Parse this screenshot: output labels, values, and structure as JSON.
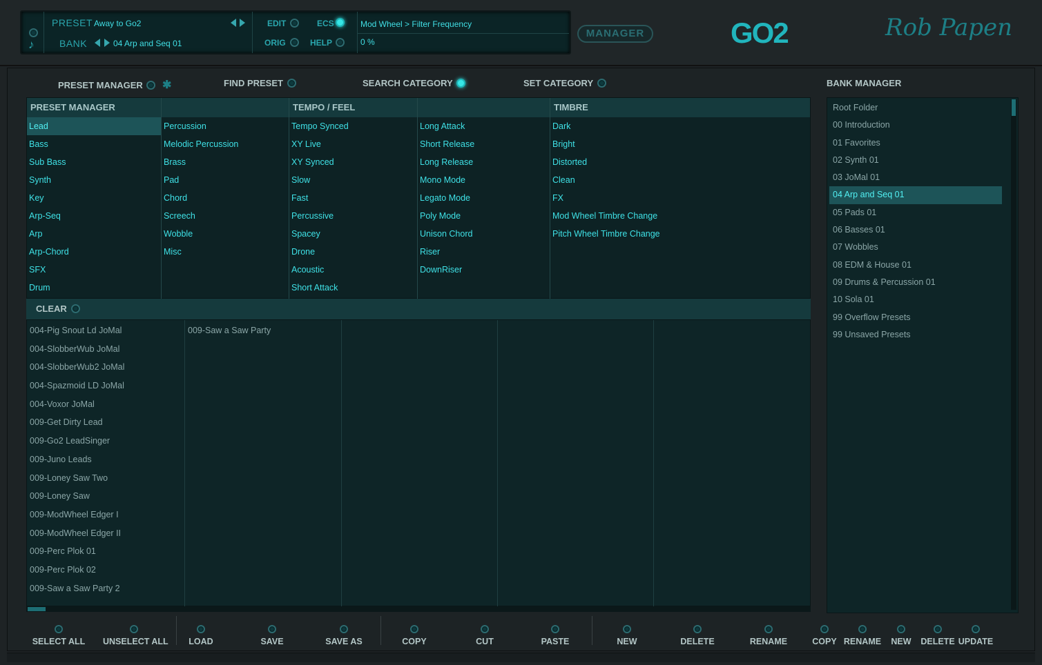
{
  "header": {
    "preset_label": "PRESET",
    "preset_name": "Away to Go2",
    "bank_label": "BANK",
    "bank_name": "04 Arp and Seq 01",
    "edit_label": "EDIT",
    "ecs_label": "ECS",
    "orig_label": "ORIG",
    "help_label": "HELP",
    "display_line1": "Mod Wheel > Filter Frequency",
    "display_line2": "0 %",
    "manager_button": "MANAGER",
    "logo_text": "GO2",
    "brand_text": "Rob Papen"
  },
  "tabs": {
    "preset_manager": "PRESET MANAGER",
    "find_preset": "FIND PRESET",
    "search_category": "SEARCH CATEGORY",
    "set_category": "SET CATEGORY",
    "bank_manager": "BANK MANAGER"
  },
  "categories": {
    "col1_header": "PRESET MANAGER",
    "col1": [
      "Lead",
      "Bass",
      "Sub Bass",
      "Synth",
      "Key",
      "Arp-Seq",
      "Arp",
      "Arp-Chord",
      "SFX",
      "Drum"
    ],
    "col2_header": "",
    "col2": [
      "Percussion",
      "Melodic Percussion",
      "Brass",
      "Pad",
      "Chord",
      "Screech",
      "Wobble",
      "Misc"
    ],
    "col3_header": "TEMPO / FEEL",
    "col3": [
      "Tempo Synced",
      "XY Live",
      "XY Synced",
      "Slow",
      "Fast",
      "Percussive",
      "Spacey",
      "Drone",
      "Acoustic",
      "Short Attack"
    ],
    "col4_header": "",
    "col4": [
      "Long Attack",
      "Short Release",
      "Long Release",
      "Mono Mode",
      "Legato Mode",
      "Poly Mode",
      "Unison Chord",
      "Riser",
      "DownRiser"
    ],
    "col5_header": "TIMBRE",
    "col5": [
      "Dark",
      "Bright",
      "Distorted",
      "Clean",
      "FX",
      "Mod Wheel Timbre Change",
      "Pitch Wheel Timbre Change"
    ]
  },
  "clear_label": "CLEAR",
  "presets": {
    "col1": [
      "004-Pig Snout Ld JoMal",
      "004-SlobberWub JoMal",
      "004-SlobberWub2 JoMal",
      "004-Spazmoid LD JoMal",
      "004-Voxor JoMal",
      "009-Get Dirty Lead",
      "009-Go2 LeadSinger",
      "009-Juno Leads",
      "009-Loney Saw Two",
      "009-Loney Saw",
      "009-ModWheel Edger I",
      "009-ModWheel Edger II",
      "009-Perc Plok 01",
      "009-Perc Plok 02",
      "009-Saw a Saw Party 2"
    ],
    "col2": [
      "009-Saw a Saw Party"
    ]
  },
  "banks": [
    "Root Folder",
    "00 Introduction",
    "01 Favorites",
    "02 Synth 01",
    "03 JoMal 01",
    "04 Arp and Seq 01",
    "05 Pads 01",
    "06 Basses 01",
    "07 Wobbles",
    "08 EDM & House 01",
    "09 Drums & Percussion 01",
    "10 Sola 01",
    "99 Overflow Presets",
    "99 Unsaved Presets"
  ],
  "bottom_buttons": [
    "SELECT ALL",
    "UNSELECT ALL",
    "LOAD",
    "SAVE",
    "SAVE AS",
    "COPY",
    "CUT",
    "PASTE",
    "NEW",
    "DELETE",
    "RENAME"
  ],
  "bank_buttons": [
    "COPY",
    "RENAME",
    "NEW",
    "DELETE",
    "UPDATE"
  ],
  "colors": {
    "accent": "#3fe1e6",
    "panel": "#0d2224",
    "header": "#153a3d",
    "selected": "#1d5458"
  }
}
